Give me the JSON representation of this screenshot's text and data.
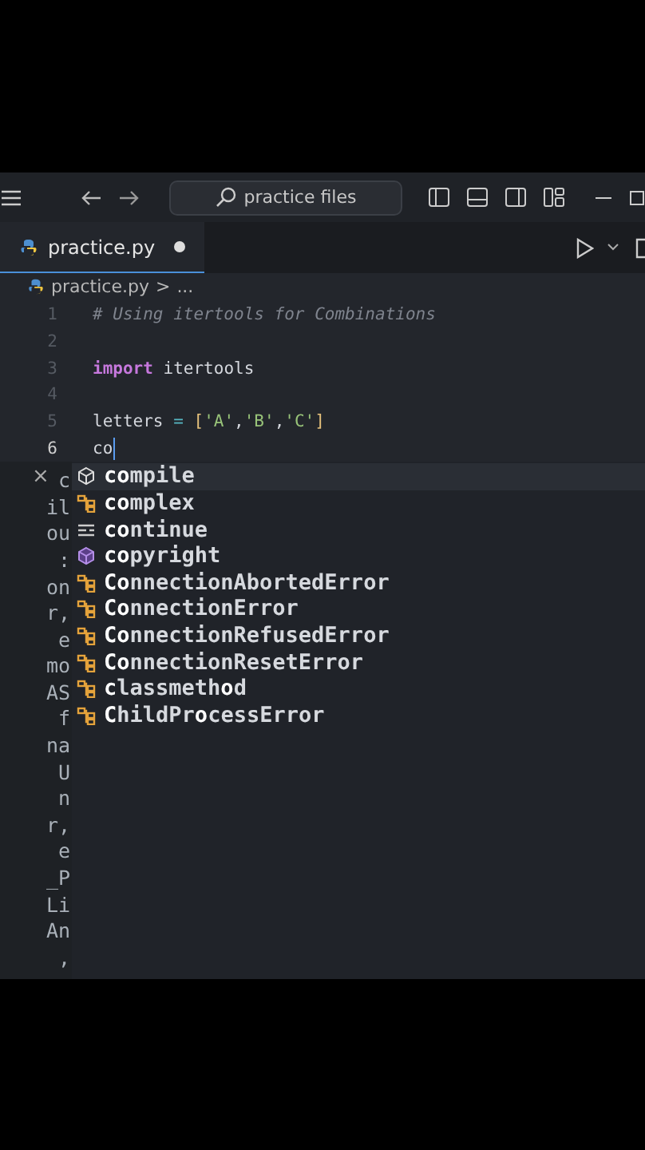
{
  "title_bar": {
    "search": {
      "value": "practice files"
    }
  },
  "tabs": [
    {
      "label": "practice.py",
      "selected": true,
      "modified": true
    }
  ],
  "breadcrumb": {
    "file": "practice.py",
    "separator": ">",
    "rest": "..."
  },
  "code": {
    "lines": [
      {
        "number": "1",
        "active": false,
        "tokens": [
          {
            "kind": "comment",
            "text": "# Using itertools for Combinations"
          }
        ]
      },
      {
        "number": "2",
        "active": false
      },
      {
        "number": "3",
        "active": false,
        "tokens": [
          {
            "kind": "keyword",
            "text": "import"
          },
          {
            "kind": "plain",
            "text": " itertools"
          }
        ]
      },
      {
        "number": "4",
        "active": false
      },
      {
        "number": "5",
        "active": false,
        "tokens": [
          {
            "kind": "plain",
            "text": "letters "
          },
          {
            "kind": "operator",
            "text": "="
          },
          {
            "kind": "bracket",
            "text": " ["
          },
          {
            "kind": "string",
            "text": "'A'"
          },
          {
            "kind": "plain",
            "text": ","
          },
          {
            "kind": "string",
            "text": "'B'"
          },
          {
            "kind": "plain",
            "text": ","
          },
          {
            "kind": "string",
            "text": "'C'"
          },
          {
            "kind": "bracket",
            "text": "]"
          }
        ]
      },
      {
        "number": "6",
        "active": true,
        "tokens": [
          {
            "kind": "plain",
            "text": "co"
          }
        ]
      }
    ]
  },
  "doc_panel": {
    "close": "×",
    "lines": [
      "c",
      "il",
      "ou",
      ":",
      "on",
      "r,",
      "e",
      "mo",
      "AS",
      "f",
      "na",
      "U",
      "n",
      "r,",
      "e",
      "_P",
      "Li",
      "An",
      ","
    ]
  },
  "suggestions": [
    {
      "kind": "module",
      "label": "**co**mpile",
      "selected": true
    },
    {
      "kind": "class",
      "label": "**co**mplex",
      "selected": false
    },
    {
      "kind": "keyword",
      "label": "**co**ntinue",
      "selected": false
    },
    {
      "kind": "variable",
      "label": "**co**pyright",
      "selected": false
    },
    {
      "kind": "class",
      "label": "**Co**nnectionAbortedError",
      "selected": false
    },
    {
      "kind": "class",
      "label": "**Co**nnectionError",
      "selected": false
    },
    {
      "kind": "class",
      "label": "**Co**nnectionRefusedError",
      "selected": false
    },
    {
      "kind": "class",
      "label": "**Co**nnectionResetError",
      "selected": false
    },
    {
      "kind": "class",
      "label": "**c**lassmeth**o**d",
      "selected": false
    },
    {
      "kind": "class",
      "label": "**C**hildPr**o**cessError",
      "selected": false
    }
  ]
}
